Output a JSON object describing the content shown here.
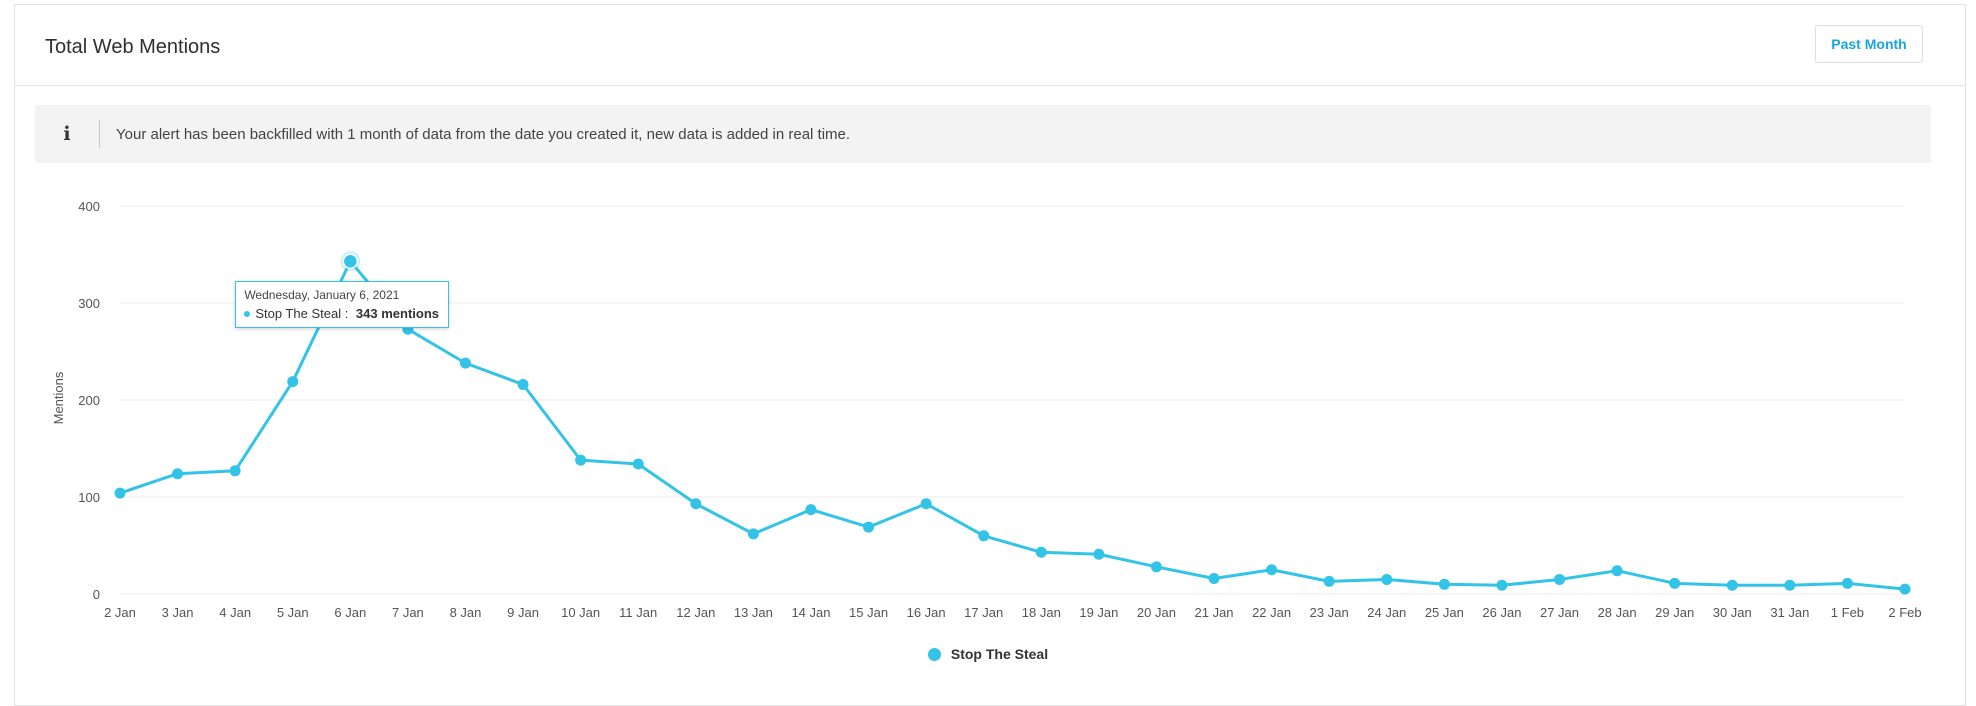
{
  "card": {
    "title": "Total Web Mentions",
    "period_label": "Past Month"
  },
  "info": {
    "icon": "info-icon",
    "text": "Your alert has been backfilled with 1 month of data from the date you created it, new data is added in real time."
  },
  "colors": {
    "series": "#33c3e6",
    "accent": "#1aa3dc",
    "grid": "#ececec",
    "banner": "#f3f3f3"
  },
  "tooltip": {
    "date": "Wednesday, January 6, 2021",
    "series": "Stop The Steal",
    "separator": " : ",
    "value": "343 mentions"
  },
  "chart_data": {
    "type": "line",
    "categories": [
      "2 Jan",
      "3 Jan",
      "4 Jan",
      "5 Jan",
      "6 Jan",
      "7 Jan",
      "8 Jan",
      "9 Jan",
      "10 Jan",
      "11 Jan",
      "12 Jan",
      "13 Jan",
      "14 Jan",
      "15 Jan",
      "16 Jan",
      "17 Jan",
      "18 Jan",
      "19 Jan",
      "20 Jan",
      "21 Jan",
      "22 Jan",
      "23 Jan",
      "24 Jan",
      "25 Jan",
      "26 Jan",
      "27 Jan",
      "28 Jan",
      "29 Jan",
      "30 Jan",
      "31 Jan",
      "1 Feb",
      "2 Feb"
    ],
    "series": [
      {
        "name": "Stop The Steal",
        "values": [
          104,
          124,
          127,
          219,
          343,
          273,
          238,
          216,
          138,
          134,
          93,
          62,
          87,
          69,
          93,
          60,
          43,
          41,
          28,
          16,
          25,
          13,
          15,
          10,
          9,
          15,
          24,
          11,
          9,
          9,
          11,
          5
        ]
      }
    ],
    "ylabel": "Mentions",
    "ylim": [
      0,
      400
    ],
    "yticks": [
      0,
      100,
      200,
      300,
      400
    ],
    "grid": true,
    "legend": "bottom-center",
    "highlighted_category": "6 Jan"
  }
}
